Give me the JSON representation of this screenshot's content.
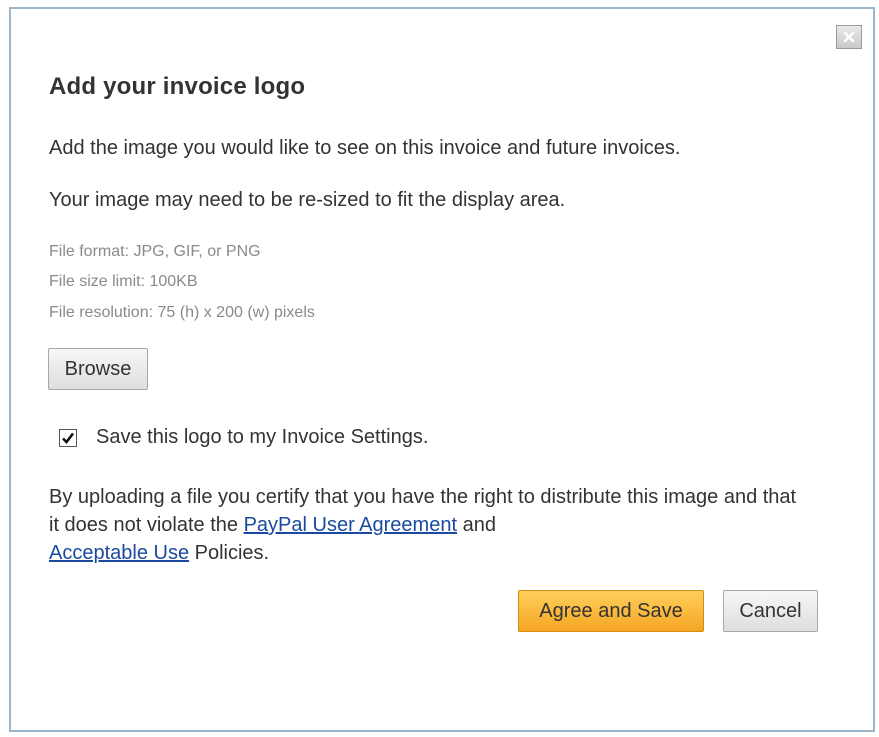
{
  "dialog": {
    "title": "Add your invoice logo",
    "close_icon": "close-x-icon",
    "intro_line_1": "Add the image you would like to see on this invoice and future invoices.",
    "intro_line_2": "Your image may need to be re-sized to fit the display area.",
    "requirements": [
      "File format: JPG, GIF, or PNG",
      "File size limit: 100KB",
      "File resolution: 75 (h) x 200 (w) pixels"
    ],
    "browse_label": "Browse",
    "save_logo": {
      "checked": true,
      "label": "Save this logo to my Invoice Settings."
    },
    "terms": {
      "text_before": "By uploading a file you certify that you have the right to distribute this image and that it does not violate the ",
      "link_user_agreement": "PayPal User Agreement",
      "text_middle": " and ",
      "link_acceptable_use": "Acceptable Use",
      "text_after": " Policies."
    },
    "agree_label": "Agree and Save",
    "cancel_label": "Cancel"
  },
  "colors": {
    "border": "#9bb5cb",
    "link": "#1a4aa0",
    "primary_button": "#f5a623"
  }
}
